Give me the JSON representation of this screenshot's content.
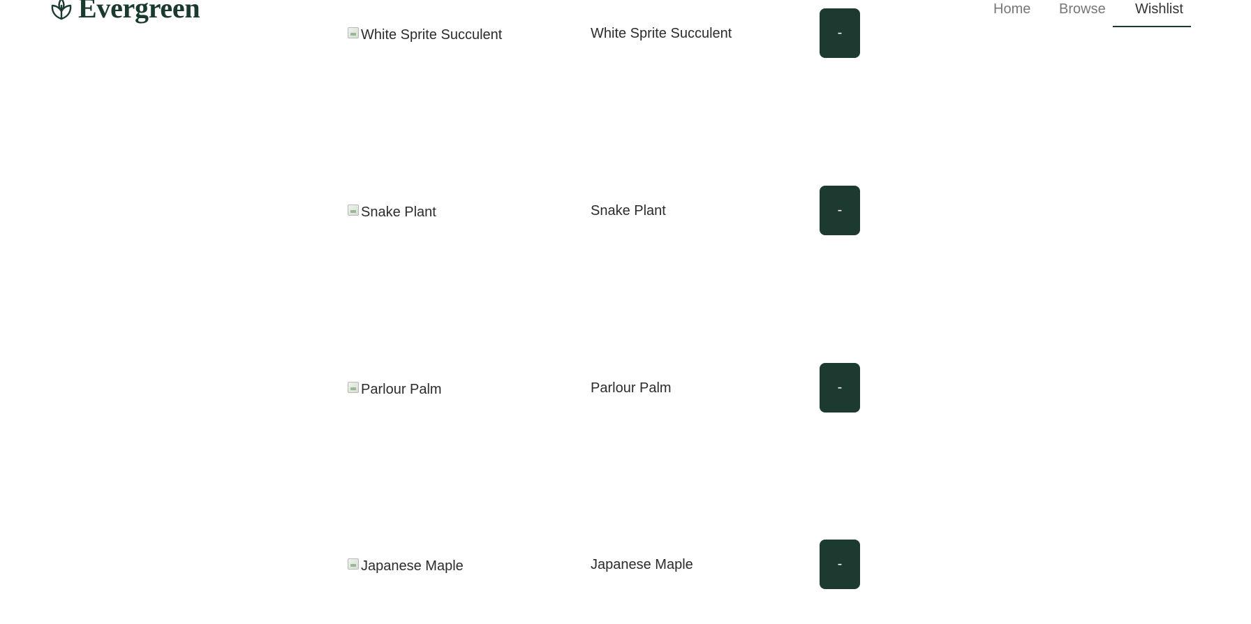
{
  "brand": {
    "name": "Evergreen",
    "icon": "leaf-icon",
    "color": "#1a3a2e"
  },
  "nav": {
    "home": "Home",
    "browse": "Browse",
    "wishlist": "Wishlist",
    "active": "wishlist"
  },
  "wishlist": {
    "items": [
      {
        "image_alt": "White Sprite Succulent",
        "name": "White Sprite Succulent",
        "remove_label": "-"
      },
      {
        "image_alt": "Snake Plant",
        "name": "Snake Plant",
        "remove_label": "-"
      },
      {
        "image_alt": "Parlour Palm",
        "name": "Parlour Palm",
        "remove_label": "-"
      },
      {
        "image_alt": "Japanese Maple",
        "name": "Japanese Maple",
        "remove_label": "-"
      }
    ]
  },
  "colors": {
    "button_bg": "#1c3a2f",
    "button_text": "#ffffff",
    "nav_inactive": "#777777",
    "nav_active": "#333333"
  }
}
